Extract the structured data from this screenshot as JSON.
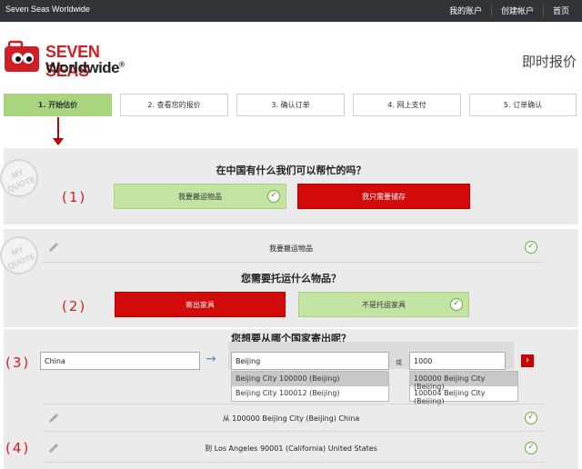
{
  "topbar": {
    "brand": "Seven Seas Worldwide",
    "links": [
      "我的账户",
      "创建帐户",
      "首页"
    ]
  },
  "logo": {
    "line1": "SEVEN SEAS",
    "line2": "Worldwide",
    "reg": "®"
  },
  "header": {
    "instant_quote": "即时报价"
  },
  "steps": [
    "1. 开始估价",
    "2. 查看您的报价",
    "3. 确认订单",
    "4. 网上支付",
    "5. 订单确认"
  ],
  "stamp": {
    "line1": "MY",
    "line2": "QUOTE"
  },
  "section1": {
    "number": "(1)",
    "question": "在中国有什么我们可以帮忙的吗？",
    "option_ship": "我要搬运物品",
    "option_store": "我只需要储存"
  },
  "section2": {
    "number": "(2)",
    "summary": "我要搬运物品",
    "question": "您需要托运什么物品？",
    "option_furniture": "寄出家具",
    "option_no_furniture": "不是托运家具"
  },
  "section3": {
    "number": "(3)",
    "question": "您想要从哪个国家寄出呢？",
    "country_value": "China",
    "city_value": "Beijing",
    "or_label": "或",
    "postcode_value": "1000",
    "go_label": "›",
    "city_suggestions": [
      "Beijing City 100000 (Beijing)",
      "Beijing City 100012 (Beijing)"
    ],
    "postcode_suggestions": [
      "100000 Beijing City (Beijing)",
      "100004 Beijing City (Beijing)"
    ],
    "from_summary": "从 100000 Beijing City (Beijing) China"
  },
  "section4": {
    "number": "(4)",
    "to_summary": "到 Los Angeles 90001 (California) United States"
  },
  "colors": {
    "accent_red": "#cf1f26",
    "active_green": "#a8d47e",
    "topbar": "#2e3438"
  }
}
